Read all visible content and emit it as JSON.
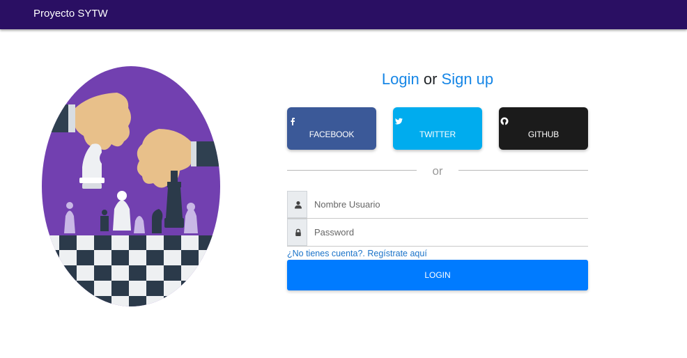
{
  "navbar": {
    "brand": "Proyecto SYTW"
  },
  "auth_title": {
    "login": "Login",
    "or": "or",
    "signup": "Sign up"
  },
  "social": {
    "facebook": {
      "label": "FACEBOOK",
      "icon": "facebook-icon",
      "color": "#3b5998"
    },
    "twitter": {
      "label": "TWITTER",
      "icon": "twitter-icon",
      "color": "#00acee"
    },
    "github": {
      "label": "GITHUB",
      "icon": "github-icon",
      "color": "#1b1b1b"
    }
  },
  "separator": {
    "text": "or"
  },
  "form": {
    "username": {
      "placeholder": "Nombre Usuario",
      "value": "",
      "icon": "user-icon"
    },
    "password": {
      "placeholder": "Password",
      "value": "",
      "icon": "lock-icon"
    },
    "register_link": "¿No tienes cuenta?. Regístrate aquí",
    "login_button": "LOGIN"
  },
  "colors": {
    "navbar": "#2a0f63",
    "primary": "#007bff",
    "link": "#1686e6",
    "illustration_bg": "#7240b0"
  }
}
